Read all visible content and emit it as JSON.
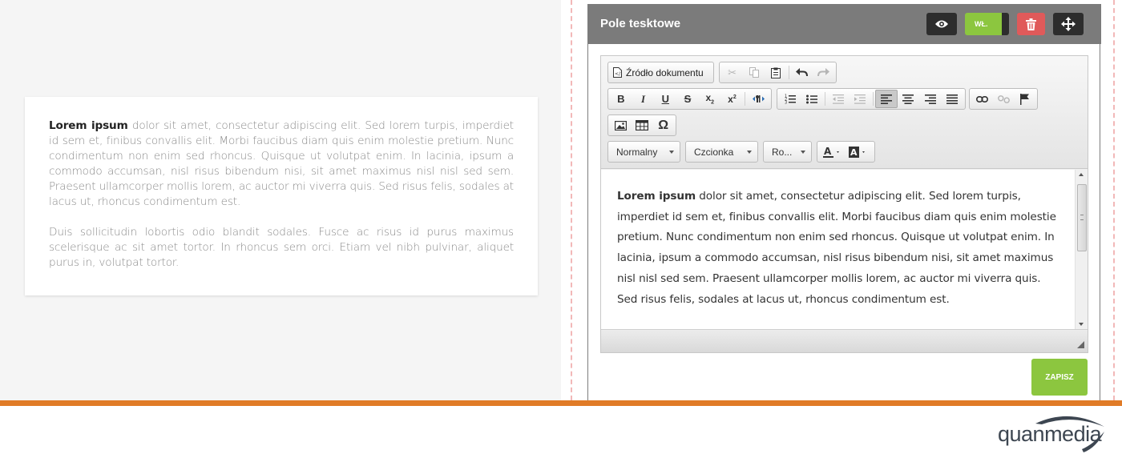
{
  "preview": {
    "p1_bold": "Lorem ipsum",
    "p1_rest": " dolor sit amet, consectetur adipiscing elit. Sed lorem turpis, imperdiet id sem et, finibus convallis elit. Morbi faucibus diam quis enim molestie pretium. Nunc condimentum non enim sed rhoncus. Quisque ut volutpat enim. In lacinia, ipsum a commodo accumsan, nisl risus bibendum nisi, sit amet maximus nisl nisl sed sem. Praesent ullamcorper mollis lorem, ac auctor mi viverra quis. Sed risus felis, sodales at lacus ut, rhoncus condimentum est.",
    "p2": "Duis sollicitudin lobortis odio blandit sodales. Fusce ac risus id purus maximus scelerisque ac sit amet tortor. In rhoncus sem orci. Etiam vel nibh pulvinar, aliquet purus in, volutpat tortor."
  },
  "panel": {
    "title": "Pole tesktowe",
    "toggle_label": "WŁ.",
    "save_label": "ZAPISZ"
  },
  "toolbar": {
    "source_label": "Źródło dokumentu",
    "format_combo": "Normalny",
    "font_combo": "Czcionka",
    "size_combo": "Ro..."
  },
  "content": {
    "p1_bold": "Lorem ipsum",
    "p1_rest": " dolor sit amet, consectetur adipiscing elit. Sed lorem turpis, imperdiet id sem et, finibus convallis elit. Morbi faucibus diam quis enim molestie pretium. Nunc condimentum non enim sed rhoncus. Quisque ut volutpat enim. In lacinia, ipsum a commodo accumsan, nisl risus bibendum nisi, sit amet maximus nisl nisl sed sem. Praesent ullamcorper mollis lorem, ac auctor mi viverra quis. Sed risus felis, sodales at lacus ut, rhoncus condimentum est."
  },
  "footer": {
    "logo_text": "quanmedia"
  },
  "colors": {
    "accent_green": "#8cc63f",
    "danger_red": "#e05a5a",
    "footer_orange": "#e07b27",
    "header_gray": "#7b7b7b"
  },
  "icons": [
    "eye-icon",
    "trash-icon",
    "move-icon",
    "source-icon",
    "cut-icon",
    "copy-icon",
    "paste-icon",
    "undo-icon",
    "redo-icon",
    "bold-icon",
    "italic-icon",
    "underline-icon",
    "strike-icon",
    "subscript-icon",
    "superscript-icon",
    "text-direction-icon",
    "numbered-list-icon",
    "bullet-list-icon",
    "outdent-icon",
    "indent-icon",
    "align-left-icon",
    "align-center-icon",
    "align-right-icon",
    "justify-icon",
    "link-icon",
    "unlink-icon",
    "anchor-icon",
    "image-icon",
    "table-icon",
    "omega-icon",
    "text-color-icon",
    "bg-color-icon",
    "resize-grip-icon"
  ]
}
